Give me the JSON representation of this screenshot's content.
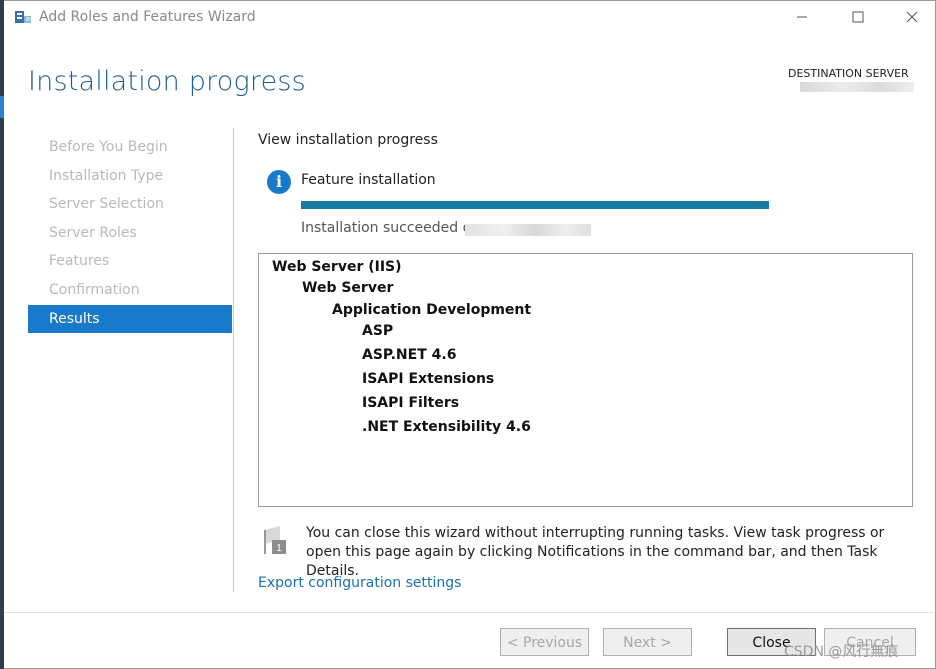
{
  "window": {
    "title": "Add Roles and Features Wizard",
    "controls": {
      "minimize": "—",
      "maximize": "☐",
      "close": "✕"
    }
  },
  "header": {
    "title": "Installation progress",
    "destination_label": "DESTINATION SERVER"
  },
  "nav": {
    "items": [
      {
        "label": "Before You Begin"
      },
      {
        "label": "Installation Type"
      },
      {
        "label": "Server Selection"
      },
      {
        "label": "Server Roles"
      },
      {
        "label": "Features"
      },
      {
        "label": "Confirmation"
      },
      {
        "label": "Results"
      }
    ],
    "active_index": 6
  },
  "content": {
    "section_title": "View installation progress",
    "feature_label": "Feature installation",
    "progress_percent": 100,
    "succeeded_text": "Installation succeeded on",
    "results_tree": [
      {
        "label": "Web Server (IIS)",
        "level": 0
      },
      {
        "label": "Web Server",
        "level": 1
      },
      {
        "label": "Application Development",
        "level": 2
      },
      {
        "label": "ASP",
        "level": 3
      },
      {
        "label": "ASP.NET 4.6",
        "level": 3
      },
      {
        "label": "ISAPI Extensions",
        "level": 3
      },
      {
        "label": "ISAPI Filters",
        "level": 3
      },
      {
        "label": ".NET Extensibility 4.6",
        "level": 3
      }
    ],
    "note": "You can close this wizard without interrupting running tasks. View task progress or open this page again by clicking Notifications in the command bar, and then Task Details.",
    "export_link": "Export configuration settings"
  },
  "buttons": {
    "previous": "< Previous",
    "next": "Next >",
    "close": "Close",
    "cancel": "Cancel"
  },
  "watermark": "CSDN @风行無痕",
  "colors": {
    "accent": "#1979ca",
    "title": "#1f5e8e",
    "progress": "#157ba1",
    "link": "#1a6fb3"
  },
  "icons": {
    "app": "server-manager-icon",
    "info": "info-icon",
    "flag": "notification-flag-icon"
  }
}
